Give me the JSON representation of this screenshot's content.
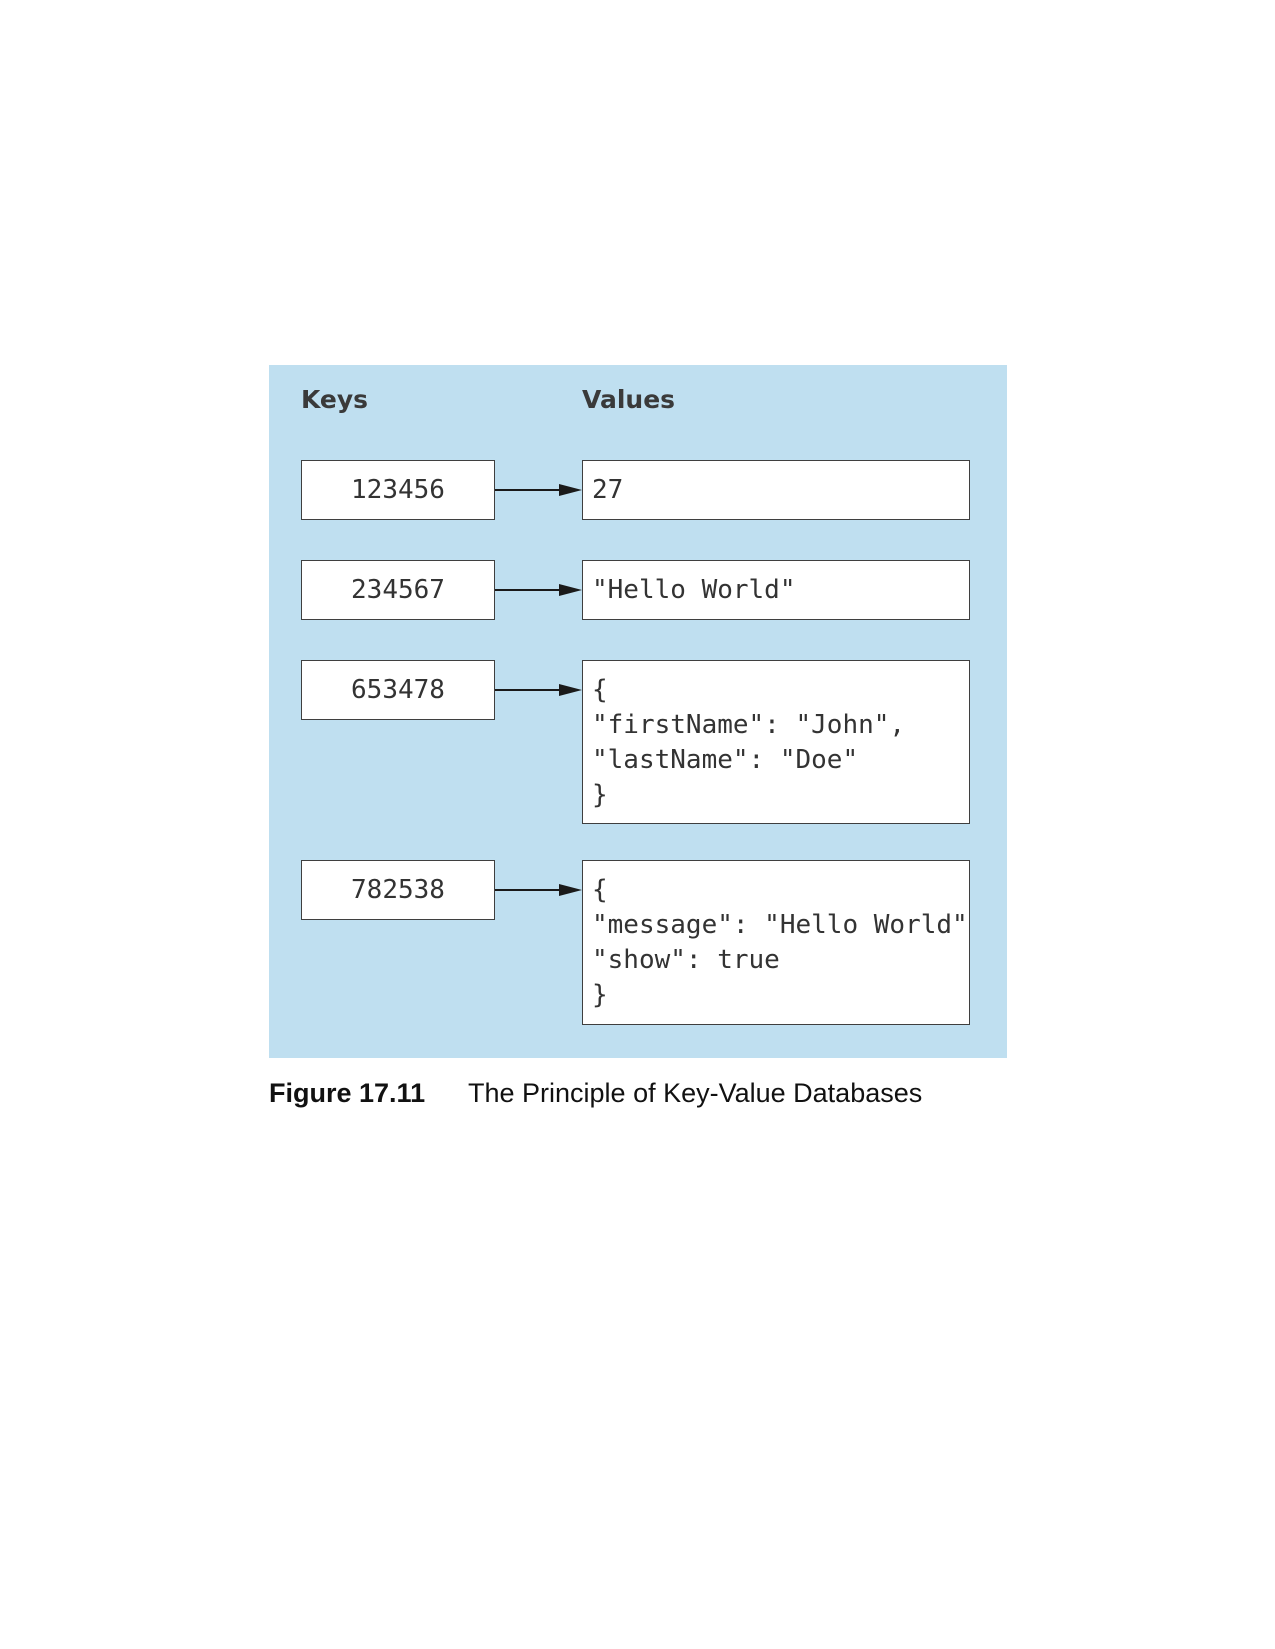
{
  "diagram": {
    "keys_header": "Keys",
    "values_header": "Values",
    "entries": [
      {
        "key": "123456",
        "value_lines": [
          "27"
        ]
      },
      {
        "key": "234567",
        "value_lines": [
          "\"Hello World\""
        ]
      },
      {
        "key": "653478",
        "value_lines": [
          "{",
          "\"firstName\": \"John\",",
          "\"lastName\": \"Doe\"",
          "}"
        ]
      },
      {
        "key": "782538",
        "value_lines": [
          "{",
          "\"message\": \"Hello World\",",
          "\"show\": true",
          "}"
        ]
      }
    ]
  },
  "caption": {
    "label": "Figure 17.11",
    "text": "The Principle of Key-Value Databases"
  },
  "colors": {
    "panel_background": "#bfdff0",
    "box_border": "#3f3f3f",
    "arrow": "#1a1a1a"
  }
}
